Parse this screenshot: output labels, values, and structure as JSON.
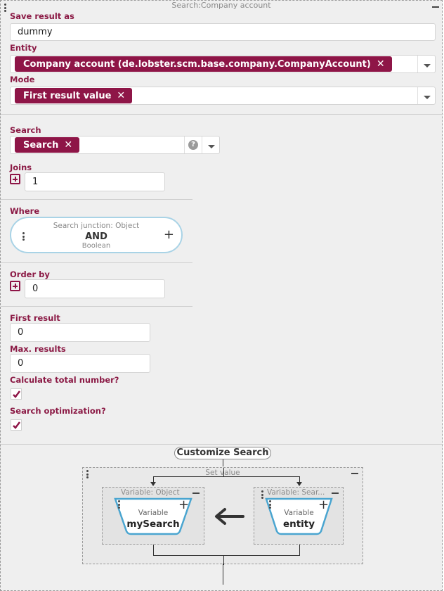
{
  "frame": {
    "title": "Search:Company account"
  },
  "save_result": {
    "label": "Save result as",
    "value": "dummy"
  },
  "entity": {
    "label": "Entity",
    "tag": "Company account (de.lobster.scm.base.company.CompanyAccount)"
  },
  "mode": {
    "label": "Mode",
    "tag": "First result value"
  },
  "search": {
    "label": "Search",
    "tag": "Search",
    "help": "?"
  },
  "joins": {
    "label": "Joins",
    "value": "1"
  },
  "where": {
    "label": "Where",
    "junction_type": "Search junction: Object",
    "junction_op": "AND",
    "junction_result": "Boolean"
  },
  "order_by": {
    "label": "Order by",
    "value": "0"
  },
  "first_result": {
    "label": "First result",
    "value": "0"
  },
  "max_results": {
    "label": "Max. results",
    "value": "0"
  },
  "calc_total": {
    "label": "Calculate total number?",
    "checked": true
  },
  "search_opt": {
    "label": "Search optimization?",
    "checked": true
  },
  "customize": {
    "label": "Customize Search"
  },
  "set_value": {
    "title": "Set value",
    "left": {
      "title": "Variable: Object",
      "kind": "Variable",
      "name": "mySearch"
    },
    "right": {
      "title": "Variable: Sear...",
      "kind": "Variable",
      "name": "entity"
    }
  },
  "colors": {
    "accent": "#8e1547",
    "junction_border": "#a9d3e6",
    "var_border": "#4aa5d0"
  }
}
